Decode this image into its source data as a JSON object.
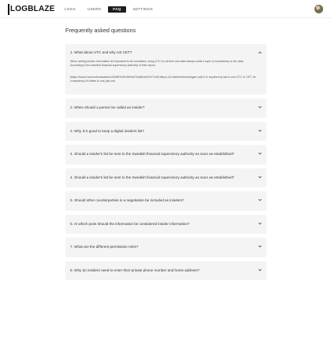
{
  "app": {
    "logo_text": "LOGBLAZE"
  },
  "nav": {
    "items": [
      {
        "label": "LOGS",
        "active": false
      },
      {
        "label": "USERS",
        "active": false
      },
      {
        "label": "FAQ",
        "active": true
      },
      {
        "label": "SETTINGS",
        "active": false
      }
    ]
  },
  "header": {
    "language_icon": "uk-flag-icon",
    "avatar_icon": "user-avatar"
  },
  "page": {
    "title": "Frequently asked questions"
  },
  "faq": {
    "items": [
      {
        "question": "1. What about UTC and why not CET?",
        "expanded": true,
        "answer_p1": "When adding insider information it's important to be consistent, using UTC for all time and date stamps adds a layer of consistency to the data. According to the swedish financial supervisory authority in their report,",
        "answer_p2": "(https://www.fi.se/contentassets/c43498f7e9f145e9a792a814e047e71e/fi-tillsyn-16-insiderforteckningarn.pdf) it is required by law to use UTC or CET, for consistency it's better to use just one."
      },
      {
        "question": "2. When should a person be called an insider?",
        "expanded": false
      },
      {
        "question": "3. Why is it good to keep a digital insiders list?",
        "expanded": false
      },
      {
        "question": "4. Should a insider's list be sent to the Swedish financial supervisory authority as soon as established?",
        "expanded": false
      },
      {
        "question": "4. Should a insider's list be sent to the Swedish financial supervisory authority as soon as established?",
        "expanded": false
      },
      {
        "question": "5. Should other counterparties in a negotiation be included as insiders?",
        "expanded": false
      },
      {
        "question": "6. At which point should the information be considered insider information?",
        "expanded": false
      },
      {
        "question": "7. What are the different permission roles?",
        "expanded": false
      },
      {
        "question": "8. Why do insiders need to enter their private phone number and home address?",
        "expanded": false
      }
    ]
  },
  "colors": {
    "accent": "#1d1d1d",
    "card_bg": "#f4f4f4",
    "page_bg": "#ffffff"
  }
}
